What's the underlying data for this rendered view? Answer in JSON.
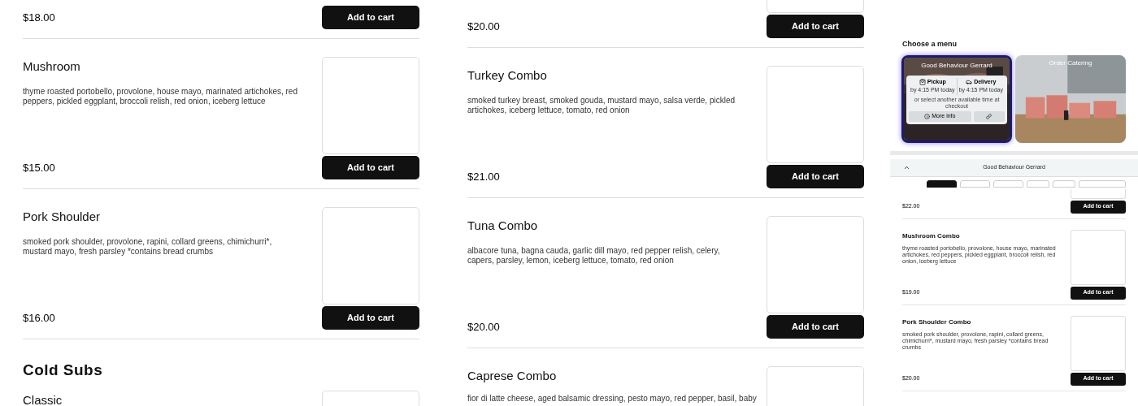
{
  "columns": [
    {
      "items": [
        {
          "kind": "partial",
          "price": "$18.00",
          "button": "Add to cart"
        },
        {
          "kind": "item",
          "name": "Mushroom",
          "description": "thyme roasted portobello, provolone, house mayo, marinated artichokes, red peppers, pickled eggplant, broccoli relish, red onion, iceberg lettuce",
          "price": "$15.00",
          "button": "Add to cart"
        },
        {
          "kind": "item",
          "name": "Pork Shoulder",
          "description": "smoked pork shoulder, provolone, rapini, collard greens, chimichurri*, mustard mayo, fresh parsley *contains bread crumbs",
          "price": "$16.00",
          "button": "Add to cart"
        },
        {
          "kind": "heading",
          "text": "Cold Subs"
        },
        {
          "kind": "cut",
          "name": "Classic"
        }
      ]
    },
    {
      "items": [
        {
          "kind": "partial-image",
          "price": "$20.00",
          "button": "Add to cart"
        },
        {
          "kind": "item",
          "name": "Turkey Combo",
          "description": "smoked turkey breast, smoked gouda, mustard mayo, salsa verde, pickled artichokes, iceberg lettuce, tomato, red onion",
          "price": "$21.00",
          "button": "Add to cart"
        },
        {
          "kind": "item",
          "name": "Tuna Combo",
          "description": "albacore tuna, bagna cauda, garlic dill mayo, red pepper relish, celery, capers, parsley, lemon, iceberg lettuce, tomato, red onion",
          "price": "$20.00",
          "button": "Add to cart"
        },
        {
          "kind": "cut",
          "name": "Caprese Combo",
          "description": "fior di latte cheese, aged balsamic dressing, pesto mayo, red pepper, basil, baby"
        }
      ]
    }
  ],
  "mini": {
    "title": "Choose a menu",
    "menus": [
      {
        "title": "Good Behaviour Gerrard",
        "selected": true,
        "pickup": {
          "label": "Pickup",
          "time": "by 4:15 PM today"
        },
        "delivery": {
          "label": "Delivery",
          "time": "by 4:15 PM today"
        },
        "note": "or select another available time at checkout",
        "more": "More info"
      },
      {
        "title": "Order Catering",
        "selected": false
      }
    ],
    "header": "Good Behaviour Gerrard",
    "tabs": [
      {
        "selected": true
      },
      {
        "selected": false
      },
      {
        "selected": false
      },
      {
        "selected": false
      },
      {
        "selected": false
      },
      {
        "selected": false
      }
    ],
    "items": [
      {
        "kind": "partial-image",
        "price": "$22.00",
        "button": "Add to cart"
      },
      {
        "kind": "item",
        "name": "Mushroom Combo",
        "description": "thyme roasted portobello, provolone, house mayo, marinated artichokes, red peppers, pickled eggplant, broccoli relish, red onion, iceberg lettuce",
        "price": "$19.00",
        "button": "Add to cart"
      },
      {
        "kind": "item",
        "name": "Pork Shoulder Combo",
        "description": "smoked pork shoulder, provolone, rapini, collard greens, chimichurri*, mustard mayo, fresh parsley *contains bread crumbs",
        "price": "$20.00",
        "button": "Add to cart"
      }
    ]
  }
}
